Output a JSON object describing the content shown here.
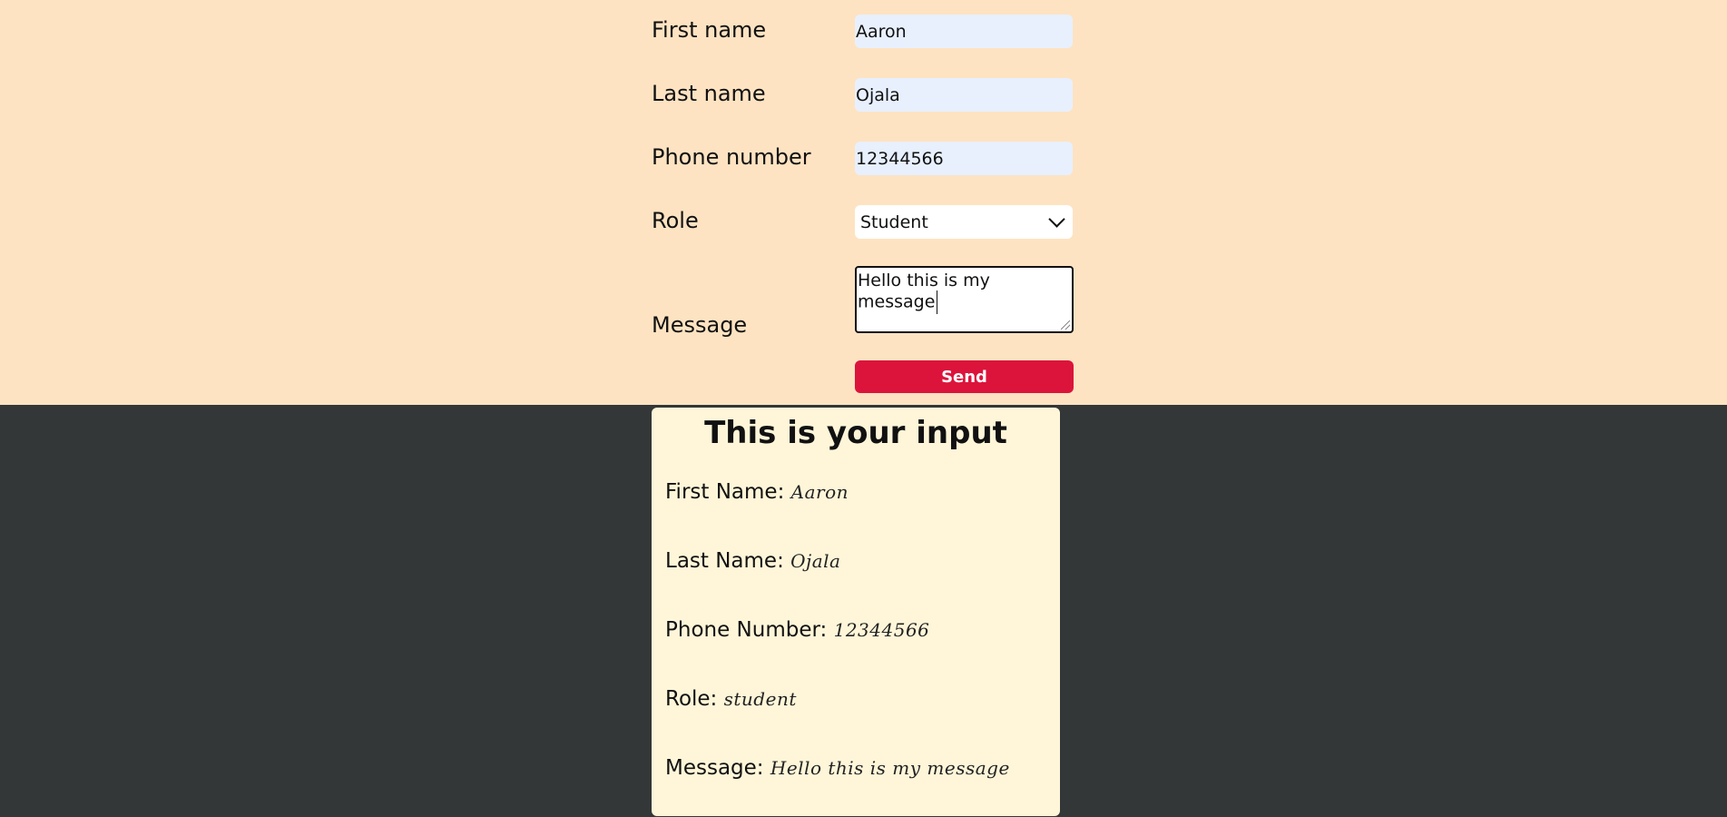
{
  "colors": {
    "top_background": "#fee3c2",
    "bottom_background": "#333738",
    "input_background": "#e8f0fe",
    "card_background": "#fff6d9",
    "send_button": "#dc143c"
  },
  "form": {
    "first_name": {
      "label": "First name",
      "value": "Aaron"
    },
    "last_name": {
      "label": "Last name",
      "value": "Ojala"
    },
    "phone": {
      "label": "Phone number",
      "value": "12344566"
    },
    "role": {
      "label": "Role",
      "value": "Student"
    },
    "message": {
      "label": "Message",
      "value": "Hello this is my message"
    },
    "send_label": "Send"
  },
  "output": {
    "title": "This is your input",
    "first_name_label": "First Name:",
    "first_name_value": "Aaron",
    "last_name_label": "Last Name:",
    "last_name_value": "Ojala",
    "phone_label": "Phone Number:",
    "phone_value": "12344566",
    "role_label": "Role:",
    "role_value": "student",
    "message_label": "Message:",
    "message_value": "Hello this is my message"
  }
}
